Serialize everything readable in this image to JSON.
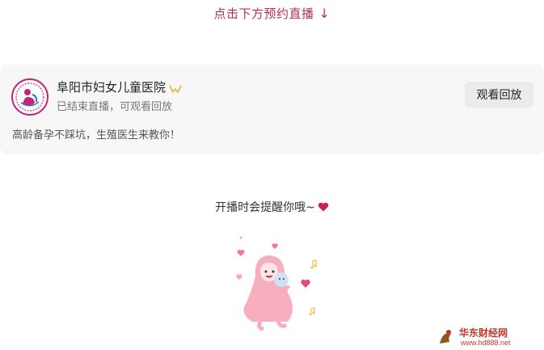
{
  "top_hint": {
    "text": "点击下方预约直播",
    "arrow": "↓"
  },
  "live_card": {
    "org_name": "阜阳市妇女儿童医院",
    "status": "已结束直播，可观看回放",
    "replay_button": "观看回放",
    "description": "高龄备孕不踩坑，生殖医生来教你！"
  },
  "remind": {
    "text": "开播时会提醒你哦~"
  },
  "watermark": {
    "brand": "华东财经网",
    "url": "www.hd888.net"
  },
  "colors": {
    "accent": "#b5324d",
    "card_bg": "#f7f7f7",
    "button_bg": "#ebebeb",
    "heart": "#c4244f"
  }
}
